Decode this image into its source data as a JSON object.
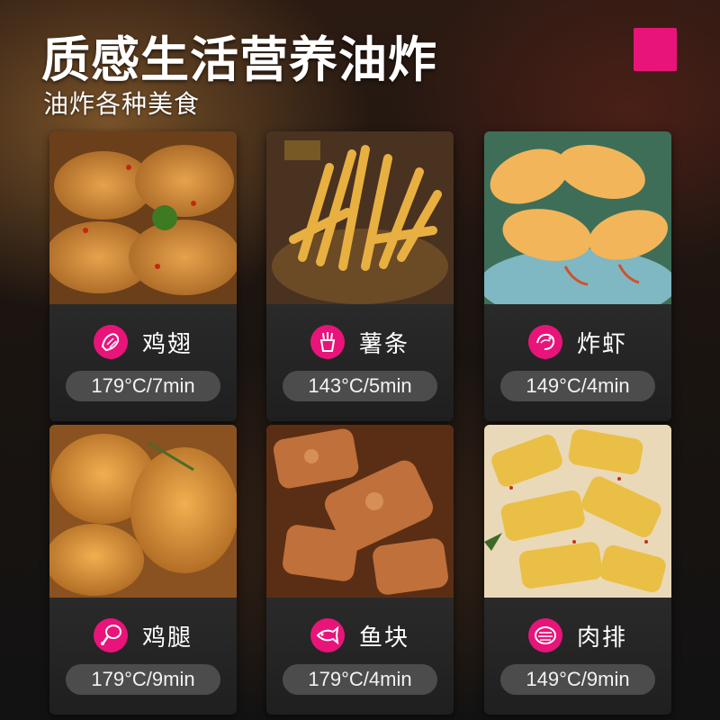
{
  "title": "质感生活营养油炸",
  "subtitle": "油炸各种美食",
  "colors": {
    "accent": "#e8147a",
    "card_bg": "#2e2e2e",
    "pill_bg": "#4c4c4c"
  },
  "items": [
    {
      "name": "鸡翅",
      "param": "179°C/7min",
      "icon": "chicken-wing-icon"
    },
    {
      "name": "薯条",
      "param": "143°C/5min",
      "icon": "fries-icon"
    },
    {
      "name": "炸虾",
      "param": "149°C/4min",
      "icon": "shrimp-icon"
    },
    {
      "name": "鸡腿",
      "param": "179°C/9min",
      "icon": "drumstick-icon"
    },
    {
      "name": "鱼块",
      "param": "179°C/4min",
      "icon": "fish-icon"
    },
    {
      "name": "肉排",
      "param": "149°C/9min",
      "icon": "steak-icon"
    }
  ]
}
